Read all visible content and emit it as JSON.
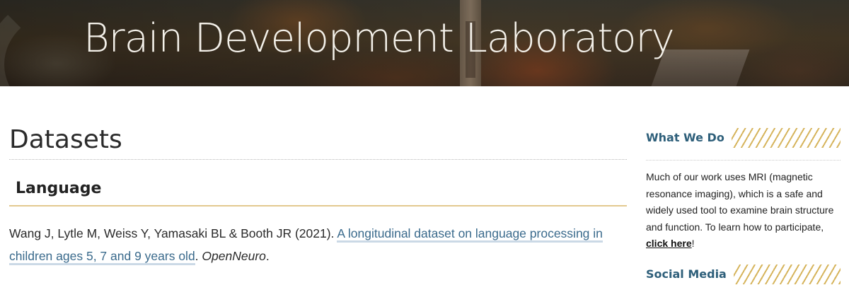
{
  "header": {
    "site_title": "Brain Development Laboratory"
  },
  "main": {
    "page_title": "Datasets",
    "sections": [
      {
        "heading": "Language",
        "citation": {
          "authors_year": "Wang J, Lytle M, Weiss Y, Yamasaki BL & Booth JR (2021). ",
          "link_text": "A longitudinal dataset on language processing in children ages 5, 7 and 9 years old",
          "period": ". ",
          "source": "OpenNeuro",
          "end": "."
        }
      }
    ]
  },
  "sidebar": {
    "what_we_do": {
      "title": "What We Do",
      "text": "Much of our work uses MRI (magnetic resonance imaging), which is a safe and widely used tool to examine brain structure and function. To learn how to participate, ",
      "link_text": "click here",
      "after_link": "!"
    },
    "social_media": {
      "title": "Social Media"
    }
  },
  "colors": {
    "title_blue": "#2e5f7a",
    "link_blue": "#3a6a8c",
    "accent_gold": "#d6b45c"
  }
}
